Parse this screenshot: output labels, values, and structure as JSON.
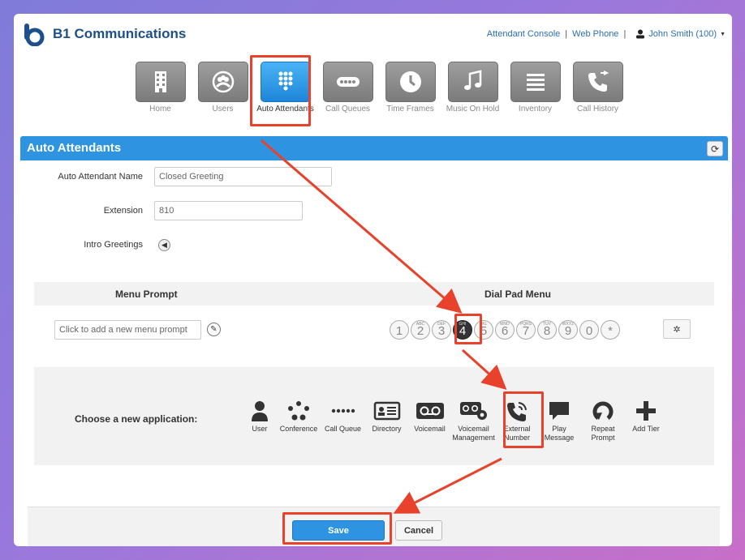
{
  "brand": {
    "name": "B1 Communications",
    "logo_icon": "b1-logo-icon",
    "color": "#1d4f8c"
  },
  "top_links": {
    "attendant_console": "Attendant Console",
    "separator": "|",
    "web_phone": "Web Phone",
    "user": "John Smith (100)"
  },
  "nav": [
    {
      "label": "Home",
      "icon": "building-icon"
    },
    {
      "label": "Users",
      "icon": "users-icon"
    },
    {
      "label": "Auto Attendants",
      "icon": "dialpad-icon",
      "active": true
    },
    {
      "label": "Call Queues",
      "icon": "dots-icon"
    },
    {
      "label": "Time Frames",
      "icon": "clock-icon"
    },
    {
      "label": "Music On Hold",
      "icon": "music-note-icon"
    },
    {
      "label": "Inventory",
      "icon": "list-icon"
    },
    {
      "label": "Call History",
      "icon": "phone-history-icon"
    }
  ],
  "section": {
    "title": "Auto Attendants",
    "accent": "#2e93e0"
  },
  "form": {
    "name_label": "Auto Attendant Name",
    "name_value": "Closed Greeting",
    "extension_label": "Extension",
    "extension_value": "810",
    "intro_label": "Intro Greetings"
  },
  "menu": {
    "prompt_header": "Menu Prompt",
    "dialpad_header": "Dial Pad Menu",
    "prompt_placeholder": "Click to add a new menu prompt",
    "keys": [
      {
        "digit": "1",
        "letters": ""
      },
      {
        "digit": "2",
        "letters": "ABC"
      },
      {
        "digit": "3",
        "letters": "DEF"
      },
      {
        "digit": "4",
        "letters": "GHI",
        "active": true
      },
      {
        "digit": "5",
        "letters": "JKL"
      },
      {
        "digit": "6",
        "letters": "MNO"
      },
      {
        "digit": "7",
        "letters": "PQRS"
      },
      {
        "digit": "8",
        "letters": "TUV"
      },
      {
        "digit": "9",
        "letters": "WXYZ"
      },
      {
        "digit": "0",
        "letters": ""
      },
      {
        "digit": "*",
        "letters": ""
      }
    ]
  },
  "applications": {
    "label": "Choose a new application:",
    "items": [
      {
        "label": "User",
        "icon": "user-icon"
      },
      {
        "label": "Conference",
        "icon": "conference-icon"
      },
      {
        "label": "Call Queue",
        "icon": "call-queue-icon"
      },
      {
        "label": "Directory",
        "icon": "directory-icon"
      },
      {
        "label": "Voicemail",
        "icon": "voicemail-icon"
      },
      {
        "label": "Voicemail Management",
        "icon": "voicemail-management-icon"
      },
      {
        "label": "External Number",
        "icon": "external-number-icon"
      },
      {
        "label": "Play Message",
        "icon": "play-message-icon"
      },
      {
        "label": "Repeat Prompt",
        "icon": "repeat-prompt-icon"
      },
      {
        "label": "Add Tier",
        "icon": "add-tier-icon"
      }
    ]
  },
  "footer": {
    "save": "Save",
    "cancel": "Cancel"
  },
  "highlight_color": "#e8422c"
}
